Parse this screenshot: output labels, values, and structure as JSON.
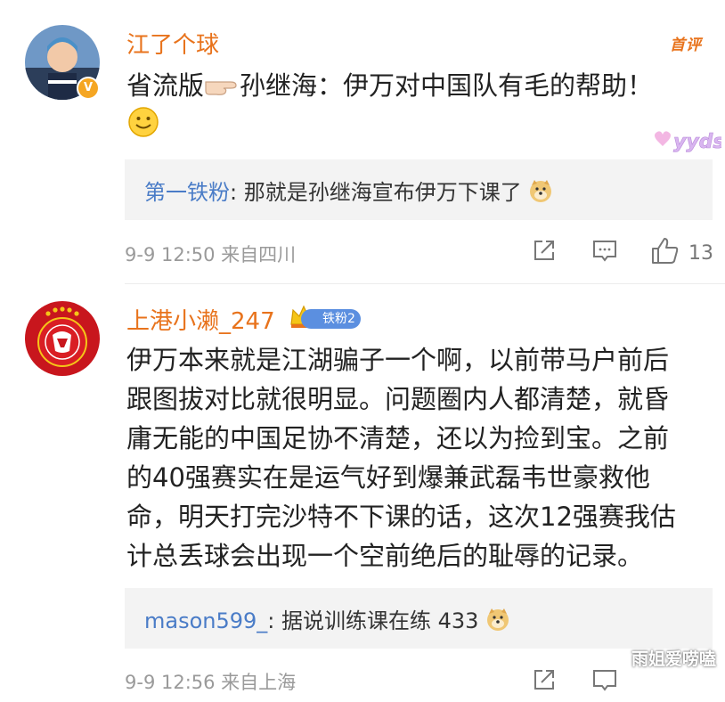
{
  "comments": [
    {
      "username": "江了个球",
      "badge": "首评",
      "text_before": "省流版",
      "text_after": "孙继海：伊万对中国队有毛的帮助！",
      "reply_user": "第一铁粉",
      "reply_text": ": 那就是孙继海宣布伊万下课了",
      "timestamp": "9-9 12:50 来自四川",
      "likes": "13",
      "sticker": "yyds"
    },
    {
      "username": "上港小濑_247",
      "fan_level": "铁粉2",
      "text_lines": [
        "伊万本来就是江湖骗子一个啊，以前带马户前后",
        "跟图拔对比就很明显。问题圈内人都清楚，就昏",
        "庸无能的中国足协不清楚，还以为捡到宝。之前",
        "的40强赛实在是运气好到爆兼武磊韦世豪救他",
        "命，明天打完沙特不下课的话，这次12强赛我估",
        "计总丢球会出现一个空前绝后的耻辱的记录。"
      ],
      "reply_user": "mason599_",
      "reply_text": ": 据说训练课在练 433",
      "timestamp": "9-9 12:56 来自上海"
    }
  ],
  "watermark": "雨姐爱唠嗑",
  "icons": [
    "share-icon",
    "comment-icon",
    "like-icon"
  ],
  "colors": {
    "username": "#e8731c",
    "reply_user": "#4a7cc7",
    "meta": "#9a9a9a"
  }
}
